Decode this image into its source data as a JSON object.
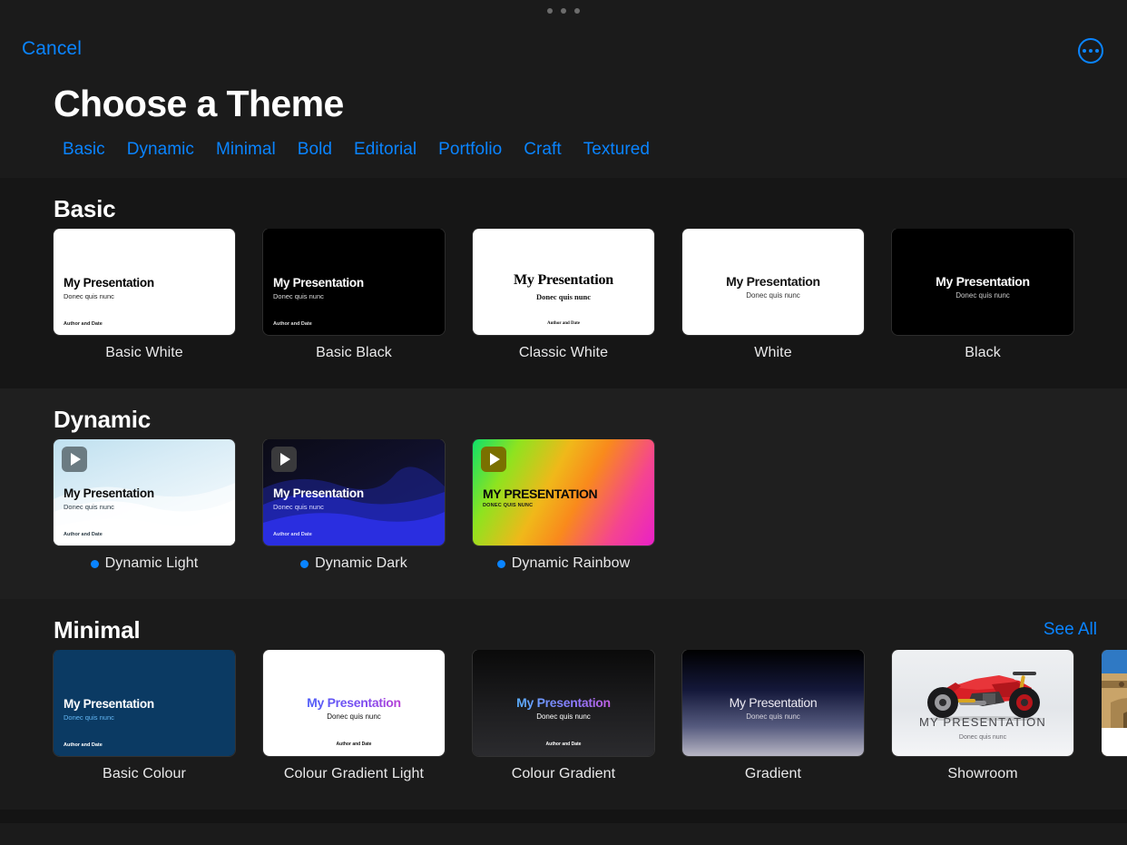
{
  "window": {
    "grabber_dots": 3
  },
  "navbar": {
    "cancel_label": "Cancel",
    "more_icon": "ellipsis-circle-icon",
    "accent_color": "#0a84ff"
  },
  "header": {
    "title": "Choose a Theme",
    "categories": [
      {
        "label": "Basic"
      },
      {
        "label": "Dynamic"
      },
      {
        "label": "Minimal"
      },
      {
        "label": "Bold"
      },
      {
        "label": "Editorial"
      },
      {
        "label": "Portfolio"
      },
      {
        "label": "Craft"
      },
      {
        "label": "Textured"
      }
    ]
  },
  "slide_text": {
    "title": "My Presentation",
    "title_upper": "MY PRESENTATION",
    "subtitle": "Donec quis nunc",
    "subtitle_upper": "DONEC QUIS NUNC",
    "author": "Author and Date"
  },
  "sections": [
    {
      "id": "basic",
      "title": "Basic",
      "see_all": null,
      "themes": [
        {
          "name": "Basic White",
          "style": "basic-white"
        },
        {
          "name": "Basic Black",
          "style": "basic-black"
        },
        {
          "name": "Classic White",
          "style": "classic-white"
        },
        {
          "name": "White",
          "style": "white"
        },
        {
          "name": "Black",
          "style": "black"
        }
      ]
    },
    {
      "id": "dynamic",
      "title": "Dynamic",
      "see_all": null,
      "themes": [
        {
          "name": "Dynamic Light",
          "style": "dynamic-light",
          "animated": true
        },
        {
          "name": "Dynamic Dark",
          "style": "dynamic-dark",
          "animated": true
        },
        {
          "name": "Dynamic Rainbow",
          "style": "dynamic-rainbow",
          "animated": true
        }
      ]
    },
    {
      "id": "minimal",
      "title": "Minimal",
      "see_all": "See All",
      "themes": [
        {
          "name": "Basic Colour",
          "style": "basic-colour"
        },
        {
          "name": "Colour Gradient Light",
          "style": "colour-gradient-light"
        },
        {
          "name": "Colour Gradient",
          "style": "colour-gradient"
        },
        {
          "name": "Gradient",
          "style": "gradient"
        },
        {
          "name": "Showroom",
          "style": "showroom"
        },
        {
          "name": "",
          "style": "desert",
          "clipped": true
        }
      ]
    }
  ]
}
